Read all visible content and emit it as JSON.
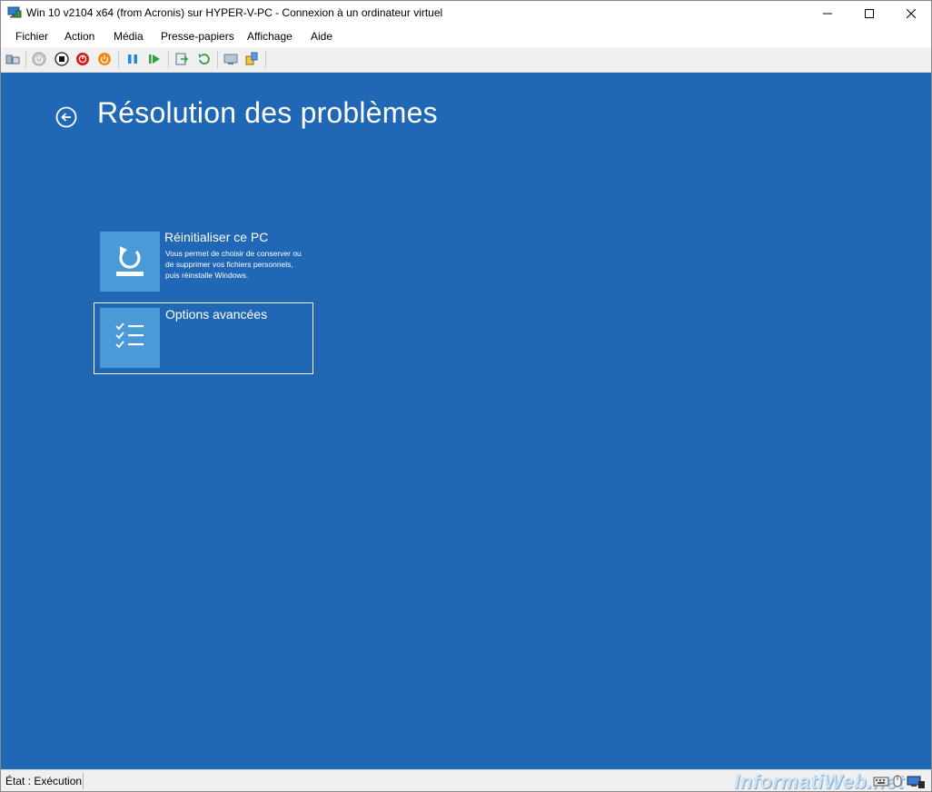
{
  "window": {
    "title": "Win 10 v2104 x64 (from Acronis) sur HYPER-V-PC - Connexion à un ordinateur virtuel"
  },
  "menu": {
    "items": [
      "Fichier",
      "Action",
      "Média",
      "Presse-papiers",
      "Affichage",
      "Aide"
    ]
  },
  "toolbar": {
    "icons": [
      "ctrl-alt-del-icon",
      "start-icon",
      "turn-off-icon",
      "shutdown-icon",
      "save-icon",
      "pause-icon",
      "resume-icon",
      "checkpoint-icon",
      "revert-icon",
      "enhanced-session-icon",
      "share-icon"
    ]
  },
  "vm": {
    "background": "#2067b5",
    "page_title": "Résolution des problèmes",
    "tiles": [
      {
        "title": "Réinitialiser ce PC",
        "description": "Vous permet de choisir de conserver ou de supprimer vos fichiers personnels, puis réinstalle Windows.",
        "icon": "reset-pc-icon",
        "selected": false
      },
      {
        "title": "Options avancées",
        "description": "",
        "icon": "checklist-icon",
        "selected": true
      }
    ]
  },
  "status": {
    "state_text": "État : Exécution"
  },
  "watermark": {
    "text": "InformatiWeb.net"
  },
  "colors": {
    "accent_tile": "#4a9ad8",
    "vm_blue": "#2067b5"
  }
}
